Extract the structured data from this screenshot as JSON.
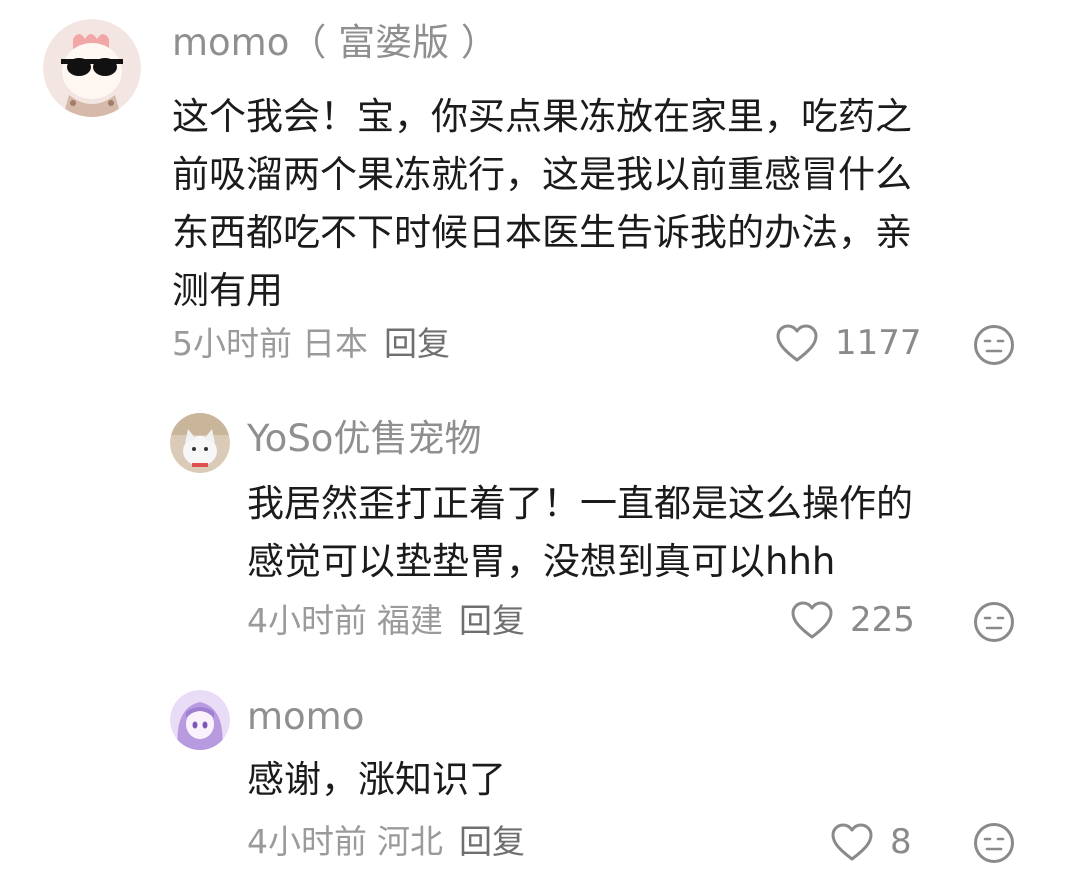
{
  "comments": [
    {
      "username": "momo（ 富婆版 ）",
      "lines": [
        "这个我会！宝，你买点果冻放在家里，吃药之",
        "前吸溜两个果冻就行，这是我以前重感冒什么",
        "东西都吃不下时候日本医生告诉我的办法，亲",
        "测有用"
      ],
      "time": "5小时前",
      "location": "日本",
      "reply_label": "回复",
      "likes": "1177",
      "avatar_icon": "cartoon-sunglasses-avatar"
    },
    {
      "username": "YoSo优售宠物",
      "lines": [
        "我居然歪打正着了！一直都是这么操作的",
        "感觉可以垫垫胃，没想到真可以hhh"
      ],
      "time": "4小时前",
      "location": "福建",
      "reply_label": "回复",
      "likes": "225",
      "avatar_icon": "white-cat-avatar"
    },
    {
      "username": "momo",
      "lines": [
        "感谢，涨知识了"
      ],
      "time": "4小时前",
      "location": "河北",
      "reply_label": "回复",
      "likes": "8",
      "avatar_icon": "anime-girl-avatar"
    }
  ],
  "colors": {
    "username": "#8f8f8f",
    "text": "#1b1b1b",
    "meta": "#9a9a9a",
    "icon": "#8a8a8a"
  }
}
